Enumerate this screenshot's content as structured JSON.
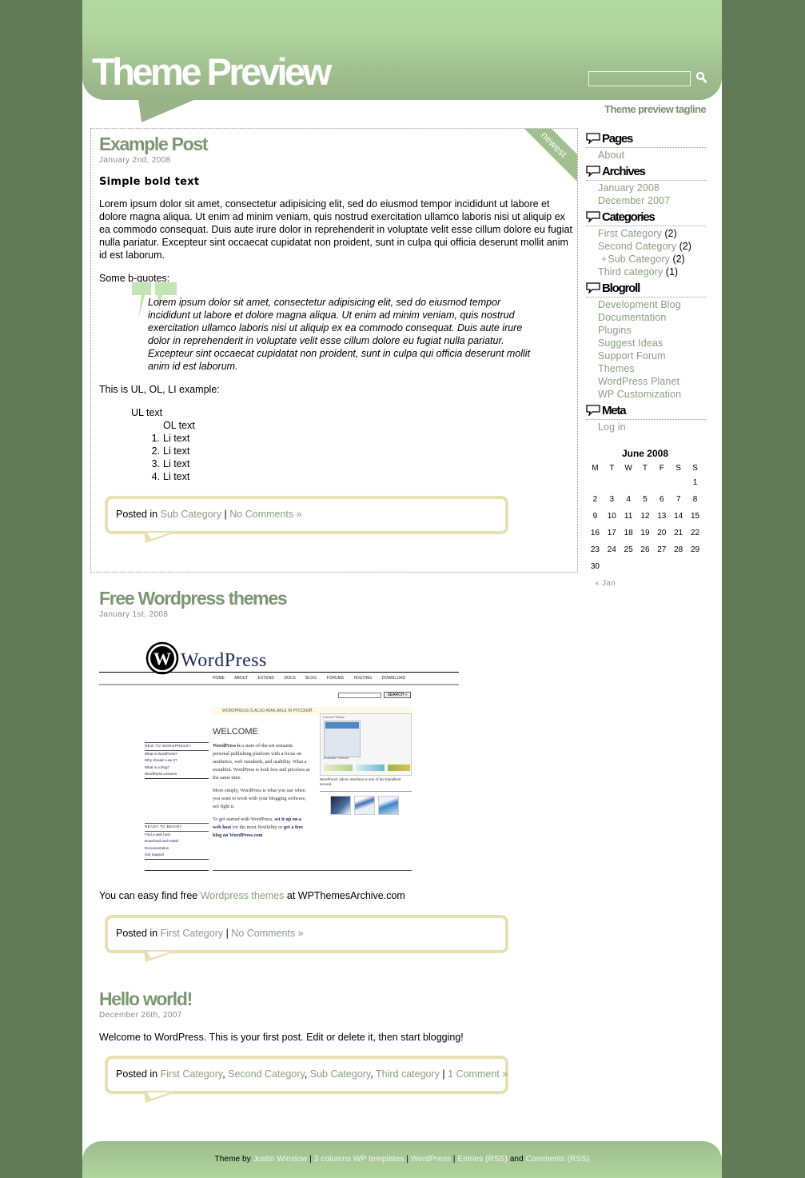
{
  "header": {
    "title": "Theme Preview",
    "tagline": "Theme preview tagline",
    "search": {
      "value": "",
      "placeholder": ""
    }
  },
  "posts": [
    {
      "title": "Example Post",
      "date": "January 2nd, 2008",
      "badge": "newest",
      "bold_text": "Simple bold text",
      "paragraph": "Lorem ipsum dolor sit amet, consectetur adipisicing elit, sed do eiusmod tempor incididunt ut labore et dolore magna aliqua. Ut enim ad minim veniam, quis nostrud exercitation ullamco laboris nisi ut aliquip ex ea commodo consequat. Duis aute irure dolor in reprehenderit in voluptate velit esse cillum dolore eu fugiat nulla pariatur. Excepteur sint occaecat cupidatat non proident, sunt in culpa qui officia deserunt mollit anim id est laborum.",
      "bquotes_label": "Some b-quotes:",
      "blockquote": "Lorem ipsum dolor sit amet, consectetur adipisicing elit, sed do eiusmod tempor incididunt ut labore et dolore magna aliqua. Ut enim ad minim veniam, quis nostrud exercitation ullamco laboris nisi ut aliquip ex ea commodo consequat. Duis aute irure dolor in reprehenderit in voluptate velit esse cillum dolore eu fugiat nulla pariatur. Excepteur sint occaecat cupidatat non proident, sunt in culpa qui officia deserunt mollit anim id est laborum.",
      "list_intro": "This is UL, OL, LI example:",
      "ul_text": "UL text",
      "ol_text": "OL text",
      "li_items": [
        "Li text",
        "Li text",
        "Li text",
        "Li text"
      ],
      "meta": {
        "posted_in": "Posted in",
        "categories": [
          "Sub Category"
        ],
        "separator": "|",
        "comments": "No Comments »"
      }
    },
    {
      "title": "Free Wordpress themes",
      "date": "January 1st, 2008",
      "text_before": "You can easy find free",
      "link": "Wordpress themes",
      "text_after": "at WPThemesArchive.com",
      "screenshot": {
        "logo": "WordPress",
        "nav": [
          "HOME",
          "ABOUT",
          "EXTEND",
          "DOCS",
          "BLOG",
          "FORUMS",
          "HOSTING",
          "DOWNLOAD"
        ],
        "search_btn": "SEARCH »",
        "notice": "WORDPRESS IS ALSO AVAILABLE IN РУССКИЙ.",
        "welcome": "WELCOME",
        "intro_bold": "WordPress is",
        "intro": "a state-of-the-art semantic personal publishing platform with a focus on aesthetics, web standards, and usability. What a mouthful. WordPress is both free and priceless at the same time.",
        "para2": "More simply, WordPress is what you use when you want to work with your blogging software, not fight it.",
        "para3_a": "To get started with WordPress,",
        "para3_link1": "set it up on a web host",
        "para3_b": "for the most flexibility or",
        "para3_link2": "get a free blog on WordPress.com",
        "new_heading": "NEW TO WORDPRESS?",
        "new_links": [
          "What is WordPress?",
          "Why should I use it?",
          "What is a blog?",
          "WordPress Lessons"
        ],
        "ready_heading": "READY TO BEGIN?",
        "ready_links": [
          "Find a web host",
          "Download and Install",
          "Documentation",
          "Get Support"
        ],
        "current_theme": "Current Theme",
        "available_themes": "Available Themes",
        "caption": "WordPress' admin interface is one of the friendliest around."
      },
      "meta": {
        "posted_in": "Posted in",
        "categories": [
          "First Category"
        ],
        "separator": "|",
        "comments": "No Comments »"
      }
    },
    {
      "title": "Hello world!",
      "date": "December 26th, 2007",
      "text": "Welcome to WordPress. This is your first post. Edit or delete it, then start blogging!",
      "meta": {
        "posted_in": "Posted in",
        "categories": [
          "First Category",
          "Second Category",
          "Sub Category",
          "Third category"
        ],
        "separator": "|",
        "comments": "1 Comment »"
      }
    }
  ],
  "sidebar": {
    "pages": {
      "title": "Pages",
      "items": [
        "About"
      ]
    },
    "archives": {
      "title": "Archives",
      "items": [
        "January 2008",
        "December 2007"
      ]
    },
    "categories": {
      "title": "Categories",
      "items": [
        {
          "label": "First Category",
          "count": "(2)"
        },
        {
          "label": "Second Category",
          "count": "(2)"
        },
        {
          "label": "Sub Category",
          "count": "(2)",
          "sub": true
        },
        {
          "label": "Third category",
          "count": "(1)"
        }
      ]
    },
    "blogroll": {
      "title": "Blogroll",
      "items": [
        "Development Blog",
        "Documentation",
        "Plugins",
        "Suggest Ideas",
        "Support Forum",
        "Themes",
        "WordPress Planet",
        "WP Customization"
      ]
    },
    "meta": {
      "title": "Meta",
      "items": [
        "Log in"
      ]
    },
    "calendar": {
      "caption": "June 2008",
      "weekdays": [
        "M",
        "T",
        "W",
        "T",
        "F",
        "S",
        "S"
      ],
      "weeks": [
        [
          "",
          "",
          "",
          "",
          "",
          "",
          "1"
        ],
        [
          "2",
          "3",
          "4",
          "5",
          "6",
          "7",
          "8"
        ],
        [
          "9",
          "10",
          "11",
          "12",
          "13",
          "14",
          "15"
        ],
        [
          "16",
          "17",
          "18",
          "19",
          "20",
          "21",
          "22"
        ],
        [
          "23",
          "24",
          "25",
          "26",
          "27",
          "28",
          "29"
        ],
        [
          "30",
          "",
          "",
          "",
          "",
          "",
          ""
        ]
      ],
      "prev": "« Jan"
    }
  },
  "footer": {
    "theme_by": "Theme by",
    "author": "Justin Winslow",
    "templates": "3 columns WP templates",
    "wordpress": "WordPress",
    "entries": "Entries (RSS)",
    "and": "and",
    "comments": "Comments (RSS)",
    "sep": "|"
  },
  "colors": {
    "background": "#617a58",
    "header_green": "#b0d69e",
    "link": "#8a9e80",
    "title": "#7d9772",
    "postmeta_border": "#e6e0b4"
  }
}
